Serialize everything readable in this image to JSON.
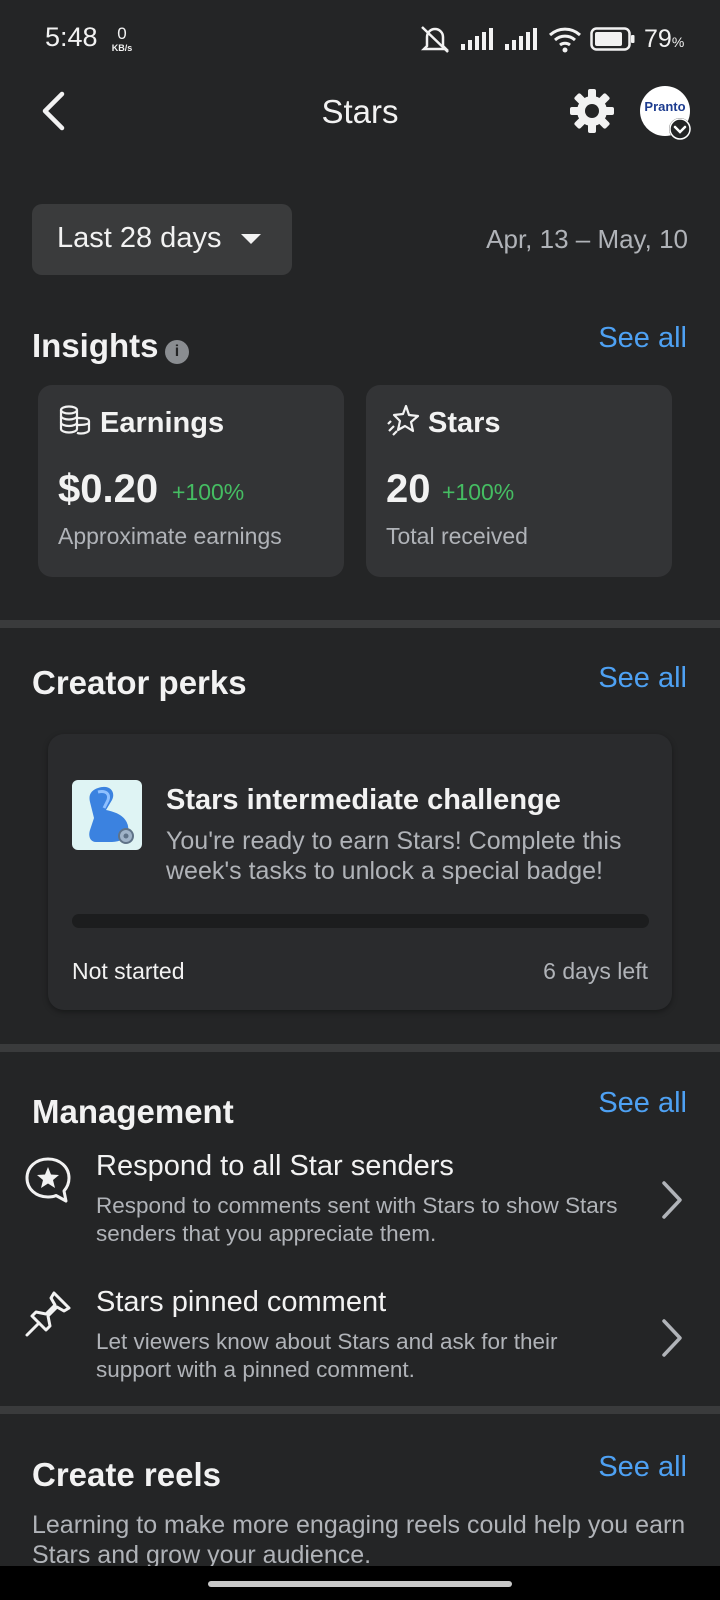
{
  "status_bar": {
    "time": "5:48",
    "net_speed_value": "0",
    "net_speed_unit": "KB/s",
    "battery_percent": "79",
    "battery_percent_sign": "%",
    "icons": [
      "mute-icon",
      "signal-icon",
      "signal-icon",
      "wifi-icon",
      "battery-icon"
    ]
  },
  "header": {
    "title": "Stars",
    "avatar_text": "Pranto"
  },
  "date_filter": {
    "label": "Last 28 days",
    "range": "Apr, 13 – May, 10"
  },
  "insights": {
    "title": "Insights",
    "see_all": "See all",
    "cards": [
      {
        "title": "Earnings",
        "icon": "coins-icon",
        "value": "$0.20",
        "change": "+100%",
        "subtitle": "Approximate earnings"
      },
      {
        "title": "Stars",
        "icon": "star-burst-icon",
        "value": "20",
        "change": "+100%",
        "subtitle": "Total received"
      }
    ]
  },
  "creator_perks": {
    "title": "Creator perks",
    "see_all": "See all",
    "card": {
      "title": "Stars intermediate challenge",
      "description": "You're ready to earn Stars! Complete this week's tasks to unlock a special badge!",
      "progress": 0,
      "status": "Not started",
      "time_left": "6 days left"
    }
  },
  "management": {
    "title": "Management",
    "see_all": "See all",
    "items": [
      {
        "title": "Respond to all Star senders",
        "description": "Respond to comments sent with Stars to show Stars senders that you appreciate them.",
        "icon": "star-comment-icon"
      },
      {
        "title": "Stars pinned comment",
        "description": "Let viewers know about Stars and ask for their support with a pinned comment.",
        "icon": "pin-icon"
      }
    ]
  },
  "create_reels": {
    "title": "Create reels",
    "see_all": "See all",
    "description": "Learning to make more engaging reels could help you earn Stars and grow your audience."
  },
  "colors": {
    "background": "#242526",
    "card": "#333436",
    "accent": "#4ea1f3",
    "positive": "#45bd62",
    "text_primary": "#f2f2f2",
    "text_secondary": "#b0b3b8"
  }
}
